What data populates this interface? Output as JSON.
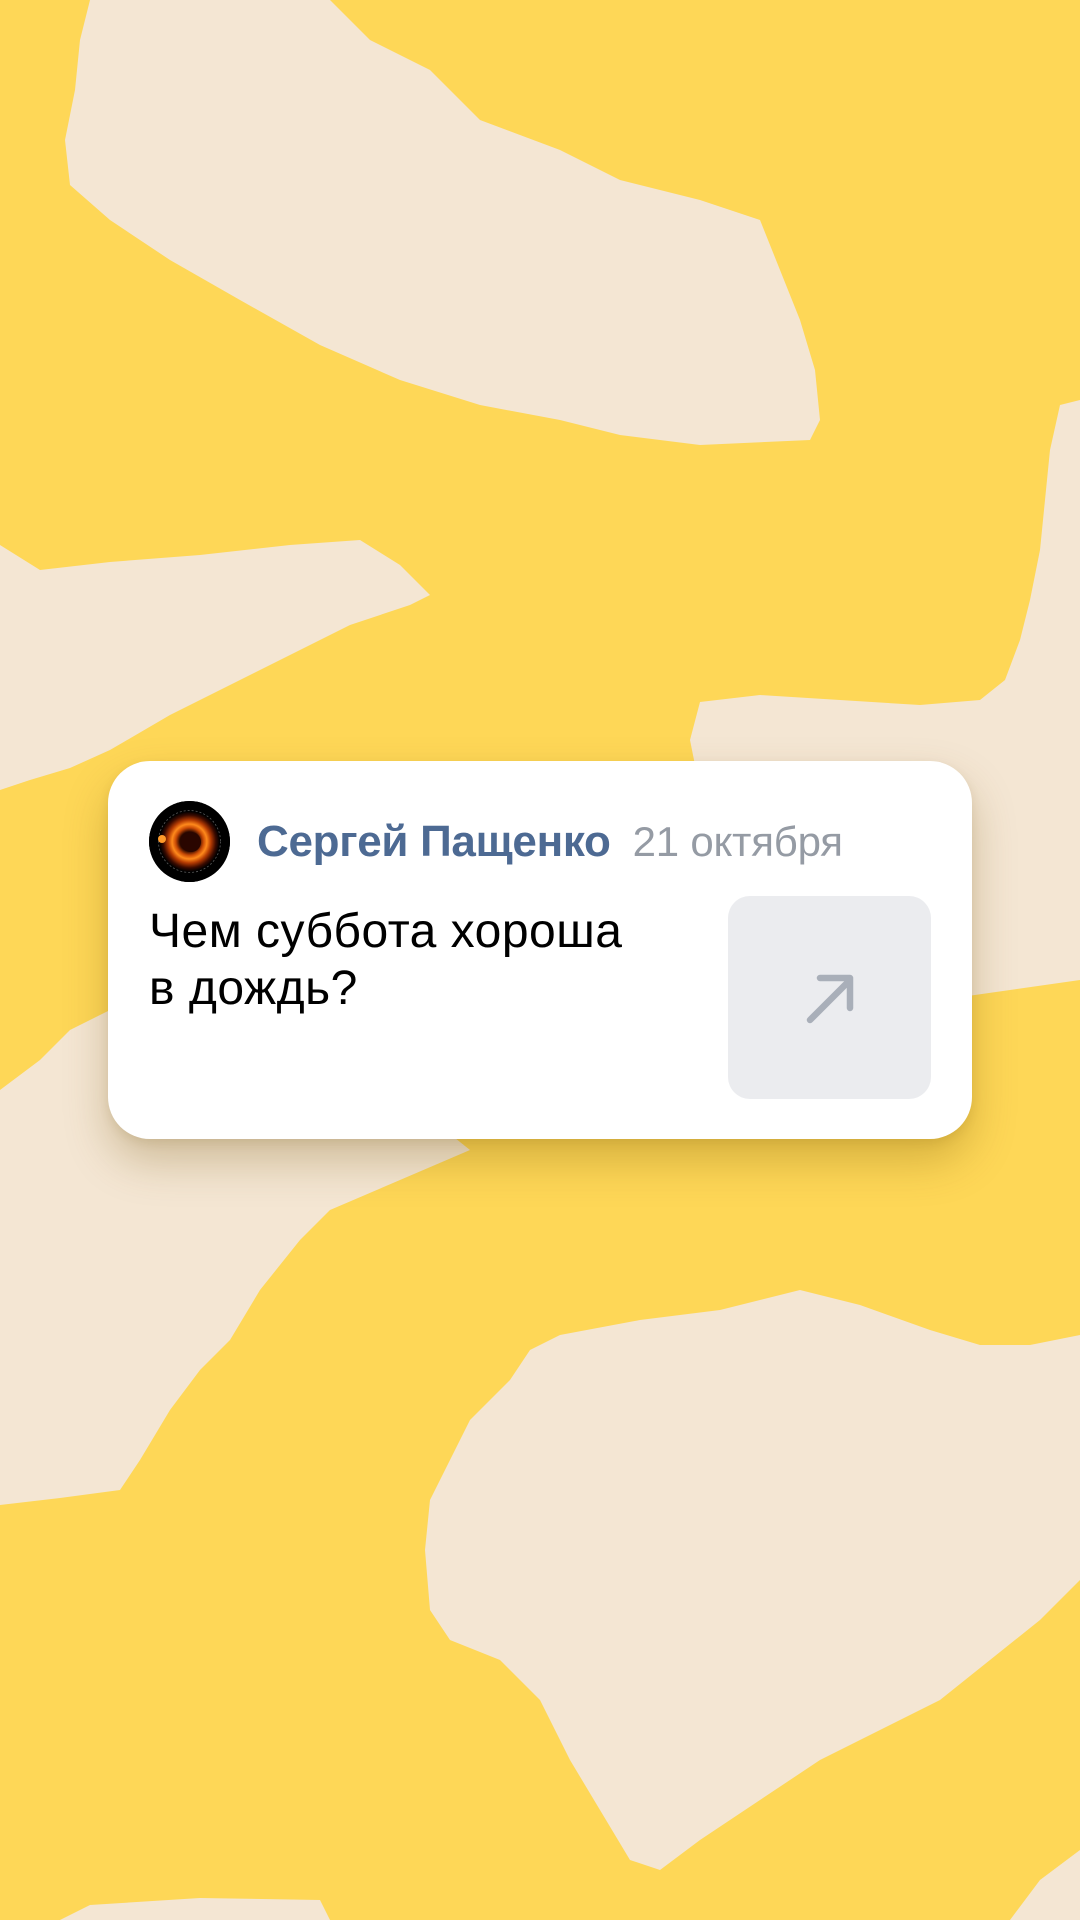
{
  "background": {
    "base_color": "#FED757",
    "shape_color": "#F4E6D3"
  },
  "notification": {
    "author_name": "Сергей Пащенко",
    "date": "21 октября",
    "text": "Чем суббота хороша\nв дождь?",
    "author_color": "#4D6A93",
    "date_color": "#959BA4",
    "avatar": "black-hole-avatar",
    "open_icon": "arrow-up-right-icon"
  }
}
